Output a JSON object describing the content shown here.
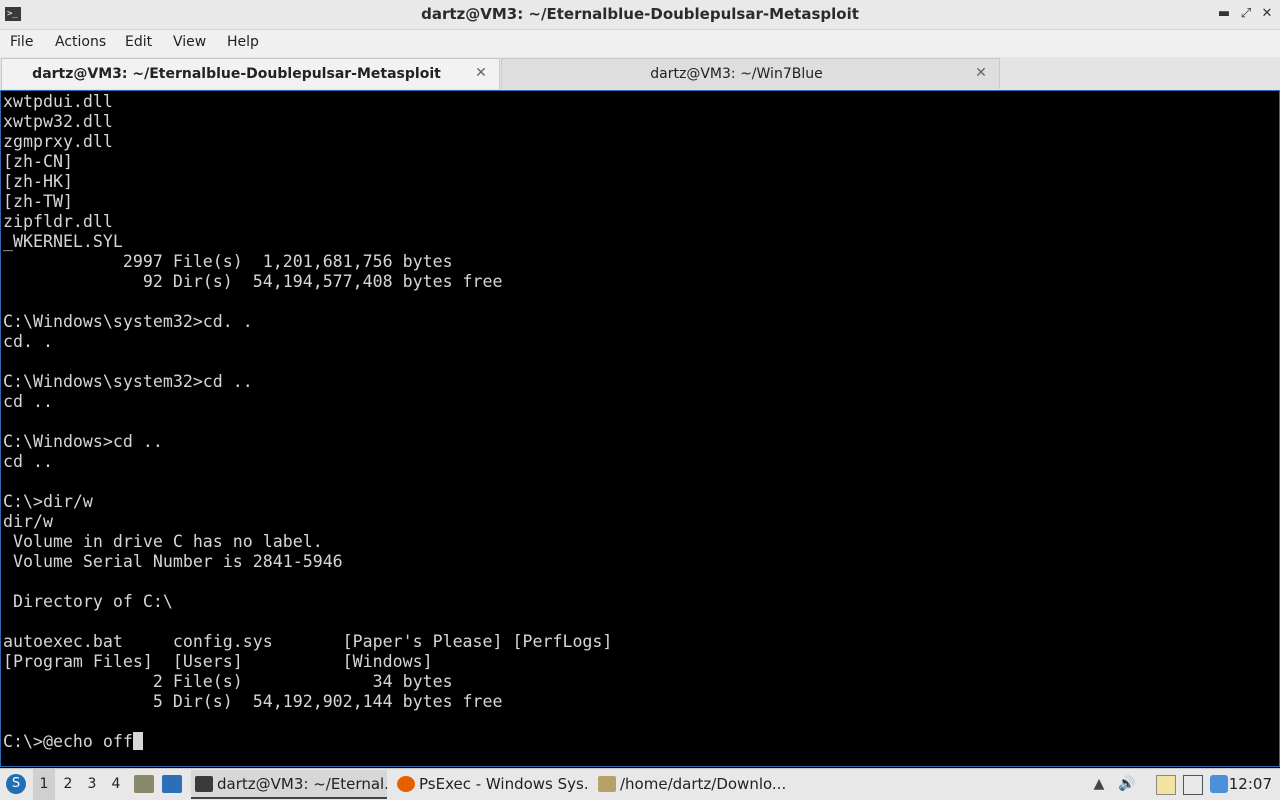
{
  "window": {
    "title": "dartz@VM3: ~/Eternalblue-Doublepulsar-Metasploit",
    "controls": {
      "minimize": "▬",
      "restore": "⤢",
      "close": "✕"
    }
  },
  "menubar": [
    "File",
    "Actions",
    "Edit",
    "View",
    "Help"
  ],
  "tabs": [
    {
      "label": "dartz@VM3: ~/Eternalblue-Doublepulsar-Metasploit",
      "active": true,
      "close": "✕"
    },
    {
      "label": "dartz@VM3: ~/Win7Blue",
      "active": false,
      "close": "✕"
    }
  ],
  "terminal": {
    "lines": [
      "xwtpdui.dll",
      "xwtpw32.dll",
      "zgmprxy.dll",
      "[zh-CN]",
      "[zh-HK]",
      "[zh-TW]",
      "zipfldr.dll",
      "_WKERNEL.SYL",
      "            2997 File(s)  1,201,681,756 bytes",
      "              92 Dir(s)  54,194,577,408 bytes free",
      "",
      "C:\\Windows\\system32>cd. .",
      "cd. .",
      "",
      "C:\\Windows\\system32>cd ..",
      "cd ..",
      "",
      "C:\\Windows>cd ..",
      "cd ..",
      "",
      "C:\\>dir/w",
      "dir/w",
      " Volume in drive C has no label.",
      " Volume Serial Number is 2841-5946",
      "",
      " Directory of C:\\",
      "",
      "autoexec.bat     config.sys       [Paper's Please] [PerfLogs]",
      "[Program Files]  [Users]          [Windows]",
      "               2 File(s)             34 bytes",
      "               5 Dir(s)  54,192,902,144 bytes free",
      "",
      "C:\\>@echo off"
    ]
  },
  "taskbar": {
    "workspaces": [
      "1",
      "2",
      "3",
      "4"
    ],
    "active_workspace": "1",
    "tasks": [
      {
        "label": "dartz@VM3: ~/Eternal...",
        "icon": "terminal-icon",
        "active": true
      },
      {
        "label": "PsExec - Windows Sys...",
        "icon": "firefox-icon",
        "active": false
      },
      {
        "label": "/home/dartz/Downlo...",
        "icon": "archive-icon",
        "active": false
      }
    ],
    "clock": "12:07"
  }
}
